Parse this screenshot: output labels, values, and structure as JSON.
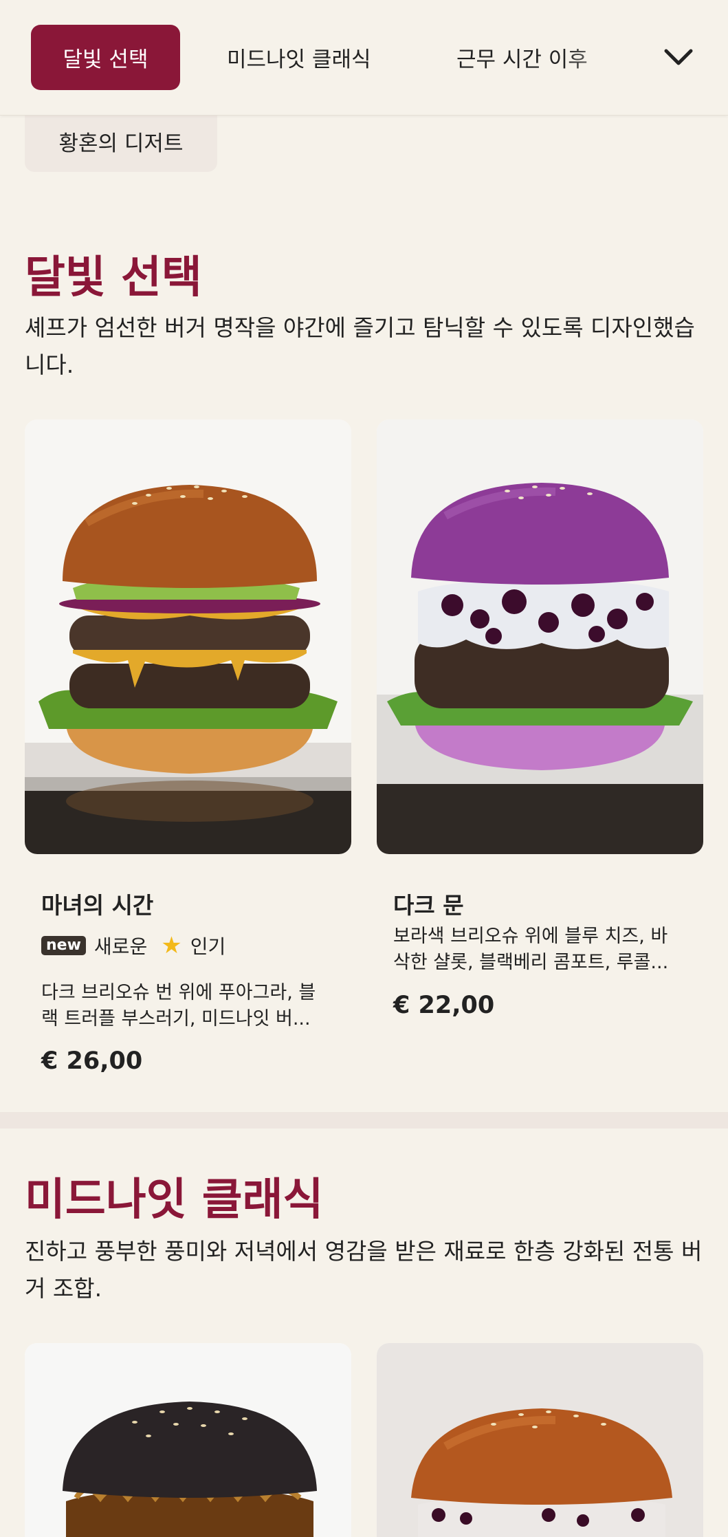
{
  "nav": {
    "tabs": [
      "달빛 선택",
      "미드나잇 클래식",
      "근무 시간 이후"
    ],
    "sub_tab": "황혼의 디저트"
  },
  "colors": {
    "accent": "#8a1738",
    "background": "#f6f2ea",
    "star": "#f3b91a"
  },
  "sections": [
    {
      "title": "달빛 선택",
      "description": "셰프가 엄선한 버거 명작을 야간에 즐기고 탐닉할 수 있도록 디자인했습니다.",
      "items": [
        {
          "name": "마녀의 시간",
          "badge_new": "new",
          "badge_new_label": "새로운",
          "badge_popular_label": "인기",
          "description": "다크 브리오슈 번 위에 푸아그라, 블랙 트러플 부스러기, 미드나잇 버...",
          "price": "€ 26,00",
          "image_icon": "burger-classic-image"
        },
        {
          "name": "다크 문",
          "description": "보라색 브리오슈 위에 블루 치즈, 바삭한 샬롯, 블랙베리 콤포트, 루콜...",
          "price": "€ 22,00",
          "image_icon": "burger-purple-image"
        }
      ]
    },
    {
      "title": "미드나잇 클래식",
      "description": "진하고 풍부한 풍미와 저녁에서 영감을 받은 재료로 한층 강화된 전통 버거 조합.",
      "items": [
        {
          "image_icon": "burger-black-bun-image"
        },
        {
          "image_icon": "burger-brioche-berry-image"
        }
      ]
    }
  ]
}
